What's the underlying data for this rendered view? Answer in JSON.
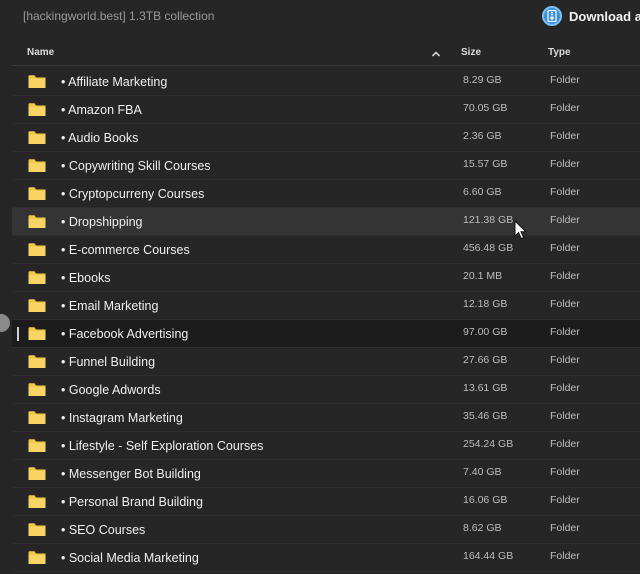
{
  "header": {
    "title": "[hackingworld.best] 1.3TB collection",
    "download_label": "Download as"
  },
  "columns": {
    "name": "Name",
    "size": "Size",
    "type": "Type"
  },
  "colors": {
    "background": "#262626",
    "folder": "#f3c94a",
    "accent": "#3d8fd6"
  },
  "icons": {
    "download": "download-zip-icon",
    "sort": "chevron-up-icon",
    "folder": "folder-icon",
    "cursor": "mouse-pointer-icon"
  },
  "rows": [
    {
      "name": "• Affiliate Marketing",
      "size": "8.29 GB",
      "type": "Folder"
    },
    {
      "name": "• Amazon FBA",
      "size": "70.05 GB",
      "type": "Folder"
    },
    {
      "name": "• Audio Books",
      "size": "2.36 GB",
      "type": "Folder"
    },
    {
      "name": "• Copywriting Skill Courses",
      "size": "15.57 GB",
      "type": "Folder"
    },
    {
      "name": "• Cryptopcurreny Courses",
      "size": "6.60 GB",
      "type": "Folder"
    },
    {
      "name": "• Dropshipping",
      "size": "121.38 GB",
      "type": "Folder",
      "state": "hover"
    },
    {
      "name": "• E-commerce Courses",
      "size": "456.48 GB",
      "type": "Folder"
    },
    {
      "name": "• Ebooks",
      "size": "20.1 MB",
      "type": "Folder"
    },
    {
      "name": "• Email Marketing",
      "size": "12.18 GB",
      "type": "Folder"
    },
    {
      "name": "• Facebook Advertising",
      "size": "97.00 GB",
      "type": "Folder",
      "state": "selected"
    },
    {
      "name": "• Funnel Building",
      "size": "27.66 GB",
      "type": "Folder"
    },
    {
      "name": "• Google Adwords",
      "size": "13.61 GB",
      "type": "Folder"
    },
    {
      "name": "• Instagram Marketing",
      "size": "35.46 GB",
      "type": "Folder"
    },
    {
      "name": "• Lifestyle - Self Exploration Courses",
      "size": "254.24 GB",
      "type": "Folder"
    },
    {
      "name": "• Messenger Bot Building",
      "size": "7.40 GB",
      "type": "Folder"
    },
    {
      "name": "• Personal Brand Building",
      "size": "16.06 GB",
      "type": "Folder"
    },
    {
      "name": "• SEO Courses",
      "size": "8.62 GB",
      "type": "Folder"
    },
    {
      "name": "• Social Media Marketing",
      "size": "164.44 GB",
      "type": "Folder"
    }
  ]
}
